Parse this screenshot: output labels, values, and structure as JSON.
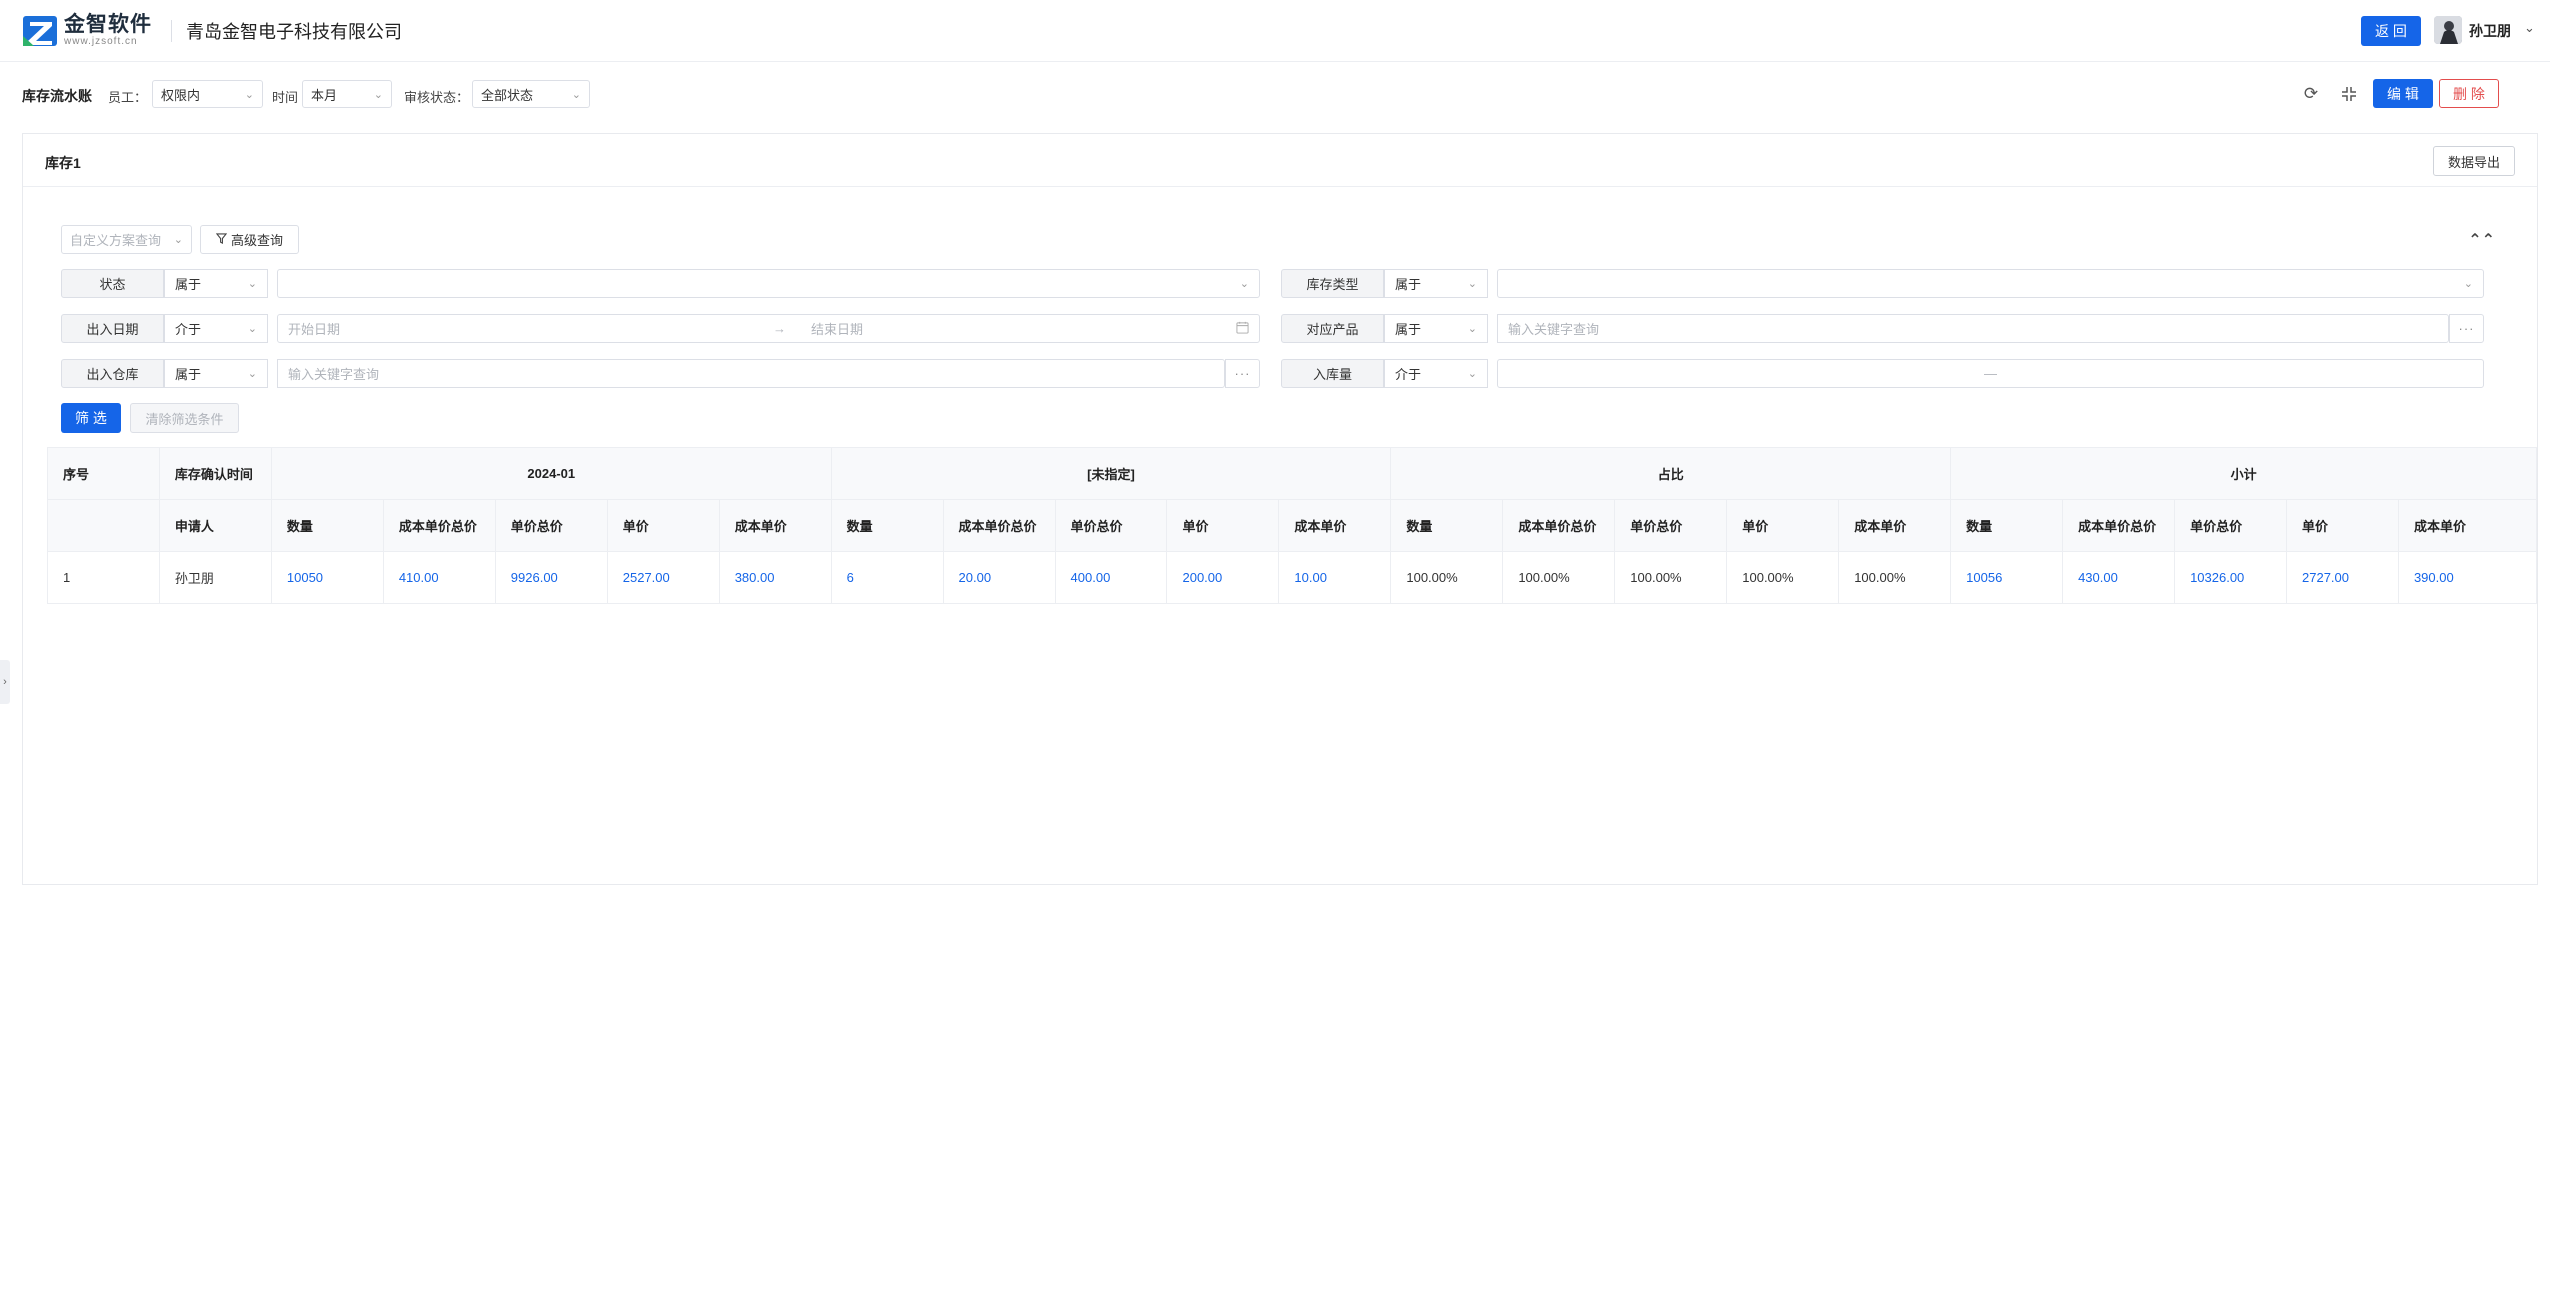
{
  "header": {
    "logo_name": "金智软件",
    "logo_url": "www.jzsoft.cn",
    "company": "青岛金智电子科技有限公司",
    "back_label": "返 回",
    "user_name": "孙卫朋"
  },
  "toolbar": {
    "title": "库存流水账",
    "employee_label": "员工：",
    "employee_value": "权限内",
    "time_label": "时间",
    "time_value": "本月",
    "audit_label": "审核状态：",
    "audit_value": "全部状态",
    "edit_label": "编 辑",
    "delete_label": "删 除"
  },
  "panel": {
    "title": "库存1",
    "export_label": "数据导出"
  },
  "filters": {
    "scheme_placeholder": "自定义方案查询",
    "advanced_label": "高级查询",
    "rows": [
      {
        "label": "状态",
        "op": "属于",
        "value": ""
      },
      {
        "label": "库存类型",
        "op": "属于",
        "value": ""
      },
      {
        "label": "出入日期",
        "op": "介于",
        "start": "开始日期",
        "end": "结束日期"
      },
      {
        "label": "对应产品",
        "op": "属于",
        "placeholder": "输入关键字查询"
      },
      {
        "label": "出入仓库",
        "op": "属于",
        "placeholder": "输入关键字查询"
      },
      {
        "label": "入库量",
        "op": "介于",
        "range_sep": "—"
      }
    ],
    "filter_label": "筛 选",
    "clear_label": "清除筛选条件"
  },
  "table": {
    "top_headers": [
      "序号",
      "库存确认时间",
      "2024-01",
      "[未指定]",
      "占比",
      "小计"
    ],
    "sub_headers": [
      "申请人",
      "数量",
      "成本单价总价",
      "单价总价",
      "单价",
      "成本单价"
    ],
    "rows": [
      {
        "index": "1",
        "applicant": "孙卫朋",
        "g1": [
          "10050",
          "410.00",
          "9926.00",
          "2527.00",
          "380.00"
        ],
        "g2": [
          "6",
          "20.00",
          "400.00",
          "200.00",
          "10.00"
        ],
        "g3": [
          "100.00%",
          "100.00%",
          "100.00%",
          "100.00%",
          "100.00%"
        ],
        "g4": [
          "10056",
          "430.00",
          "10326.00",
          "2727.00",
          "390.00"
        ]
      }
    ]
  }
}
